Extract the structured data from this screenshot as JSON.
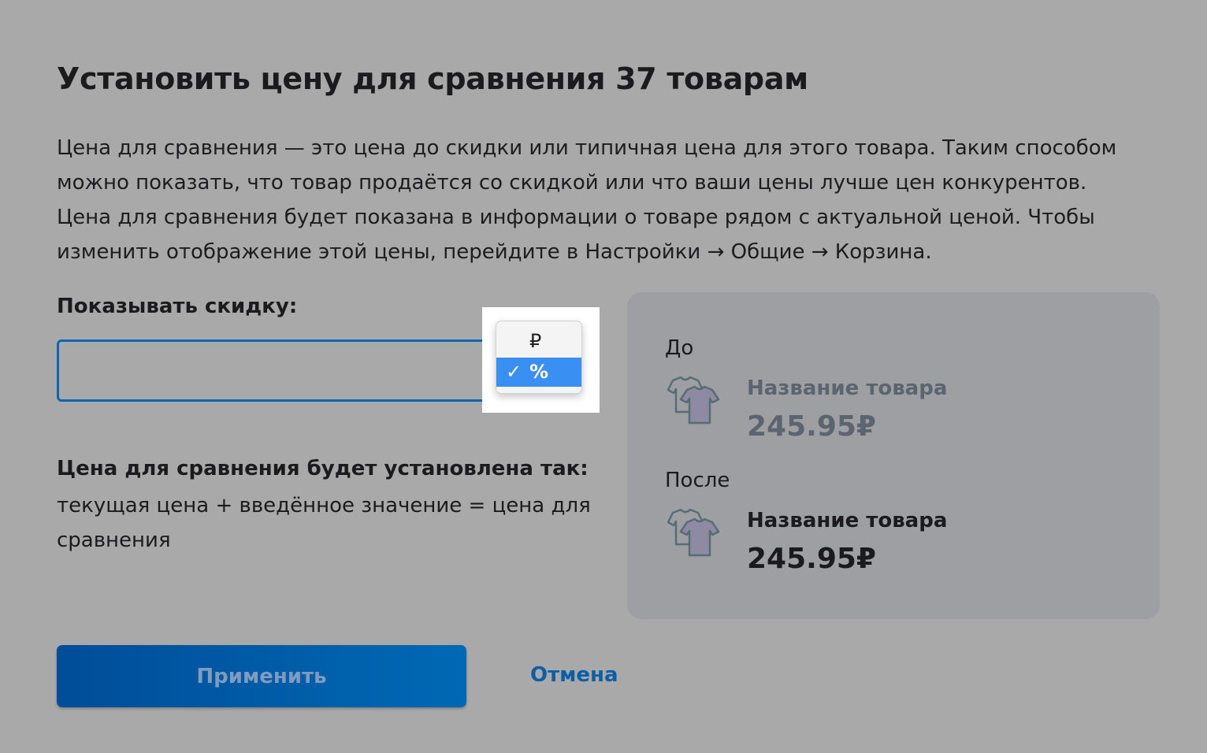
{
  "dialog": {
    "title": "Установить цену для сравнения 37 товарам",
    "description": "Цена для сравнения — это цена до скидки или типичная цена для этого товара. Таким способом можно показать, что товар продаётся со скидкой или что ваши цены лучше цен конкурентов. Цена для сравнения будет показана в информации о товаре рядом с актуальной ценой. Чтобы изменить отображение этой цены, перейдите в Настройки → Общие → Корзина."
  },
  "discount": {
    "label": "Показывать скидку:",
    "value": "",
    "unit_options": [
      {
        "label": "₽",
        "selected": false
      },
      {
        "label": "%",
        "selected": true,
        "check": "✓"
      }
    ]
  },
  "formula": {
    "heading": "Цена для сравнения будет установлена так:",
    "text": "текущая цена + введённое значение = цена для сравнения"
  },
  "preview": {
    "before": {
      "label": "До",
      "product_name": "Название товара",
      "price": "245.95₽"
    },
    "after": {
      "label": "После",
      "product_name": "Название товара",
      "price": "245.95₽"
    },
    "icon": "tshirts-icon"
  },
  "actions": {
    "apply_label": "Применить",
    "cancel_label": "Отмена"
  }
}
